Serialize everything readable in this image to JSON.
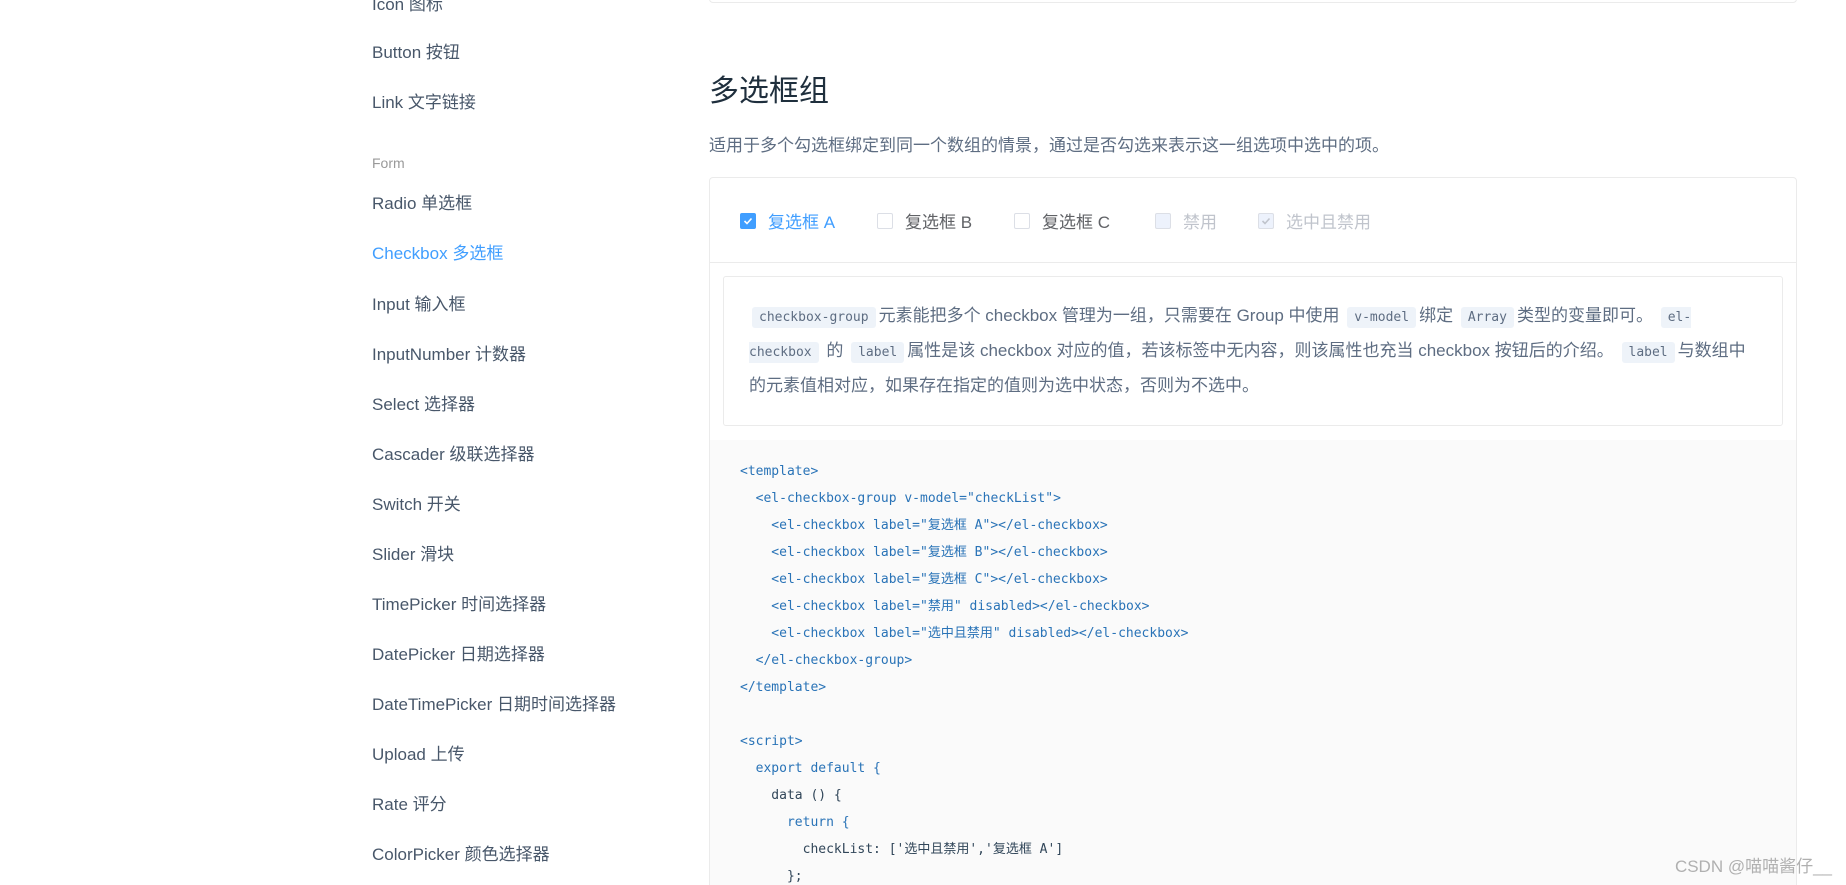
{
  "sidebar": {
    "items": [
      {
        "label": "Icon 图标"
      },
      {
        "label": "Button 按钮"
      },
      {
        "label": "Link 文字链接"
      }
    ],
    "group": "Form",
    "form_items": [
      {
        "label": "Radio 单选框"
      },
      {
        "label": "Checkbox 多选框"
      },
      {
        "label": "Input 输入框"
      },
      {
        "label": "InputNumber 计数器"
      },
      {
        "label": "Select 选择器"
      },
      {
        "label": "Cascader 级联选择器"
      },
      {
        "label": "Switch 开关"
      },
      {
        "label": "Slider 滑块"
      },
      {
        "label": "TimePicker 时间选择器"
      },
      {
        "label": "DatePicker 日期选择器"
      },
      {
        "label": "DateTimePicker 日期时间选择器"
      },
      {
        "label": "Upload 上传"
      },
      {
        "label": "Rate 评分"
      },
      {
        "label": "ColorPicker 颜色选择器"
      }
    ],
    "active": "Checkbox 多选框"
  },
  "section": {
    "title": "多选框组",
    "description": "适用于多个勾选框绑定到同一个数组的情景，通过是否勾选来表示这一组选项中选中的项。"
  },
  "demo": {
    "checkboxes": [
      {
        "label": "复选框 A",
        "checked": true,
        "disabled": false
      },
      {
        "label": "复选框 B",
        "checked": false,
        "disabled": false
      },
      {
        "label": "复选框 C",
        "checked": false,
        "disabled": false
      },
      {
        "label": "禁用",
        "checked": false,
        "disabled": true
      },
      {
        "label": "选中且禁用",
        "checked": true,
        "disabled": true
      }
    ]
  },
  "doc": {
    "code1": "checkbox-group",
    "text1": "元素能把多个 checkbox 管理为一组，只需要在 Group 中使用",
    "code2": "v-model",
    "text2": "绑定",
    "code3": "Array",
    "text3": "类型的变量即可。",
    "code4": "el-checkbox",
    "text4": "的",
    "code5": "label",
    "text5": "属性是该 checkbox 对应的值，若该标签中无内容，则该属性也充当 checkbox 按钮后的介绍。",
    "code6": "label",
    "text6": "与数组中的元素值相对应，如果存在指定的值则为选中状态，否则为不选中。"
  },
  "code": {
    "lines": [
      "<template>",
      "  <el-checkbox-group v-model=\"checkList\">",
      "    <el-checkbox label=\"复选框 A\"></el-checkbox>",
      "    <el-checkbox label=\"复选框 B\"></el-checkbox>",
      "    <el-checkbox label=\"复选框 C\"></el-checkbox>",
      "    <el-checkbox label=\"禁用\" disabled></el-checkbox>",
      "    <el-checkbox label=\"选中且禁用\" disabled></el-checkbox>",
      "  </el-checkbox-group>",
      "</template>",
      "",
      "<script>",
      "  export default {",
      "    data () {",
      "      return {",
      "        checkList: ['选中且禁用','复选框 A']",
      "      };"
    ]
  },
  "watermark": "CSDN @喵喵酱仔__",
  "colors": {
    "accent": "#409eff",
    "text": "#48576a",
    "disabled": "#c0c4cc"
  }
}
